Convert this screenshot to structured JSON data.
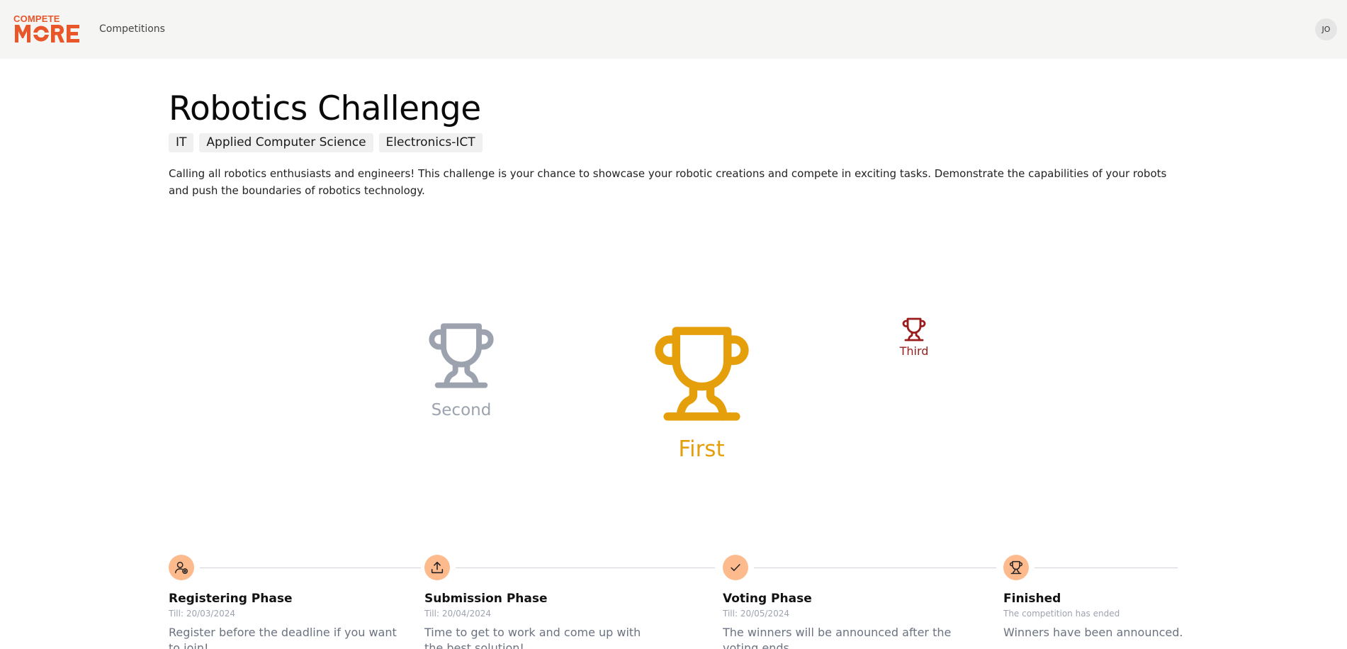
{
  "header": {
    "logo_top": "COMPETE",
    "logo_main": "MORE",
    "nav": [
      {
        "label": "Competitions"
      }
    ],
    "user_initials": "JO",
    "brand_color": "#e8562a"
  },
  "competition": {
    "title": "Robotics Challenge",
    "tags": [
      "IT",
      "Applied Computer Science",
      "Electronics-ICT"
    ],
    "description": "Calling all robotics enthusiasts and engineers! This challenge is your chance to showcase your robotic creations and compete in exciting tasks. Demonstrate the capabilities of your robots and push the boundaries of robotics technology."
  },
  "podium": {
    "second": {
      "label": "Second",
      "icon": "trophy-icon",
      "color": "#9ca3af"
    },
    "first": {
      "label": "First",
      "icon": "trophy-icon",
      "color": "#e59f0b"
    },
    "third": {
      "label": "Third",
      "icon": "trophy-icon",
      "color": "#991b1b"
    }
  },
  "phases": [
    {
      "title": "Registering Phase",
      "till": "Till: 20/03/2024",
      "description": "Register before the deadline if you want to join!",
      "icon": "user-plus-icon"
    },
    {
      "title": "Submission Phase",
      "till": "Till: 20/04/2024",
      "description": "Time to get to work and come up with the best solution!",
      "icon": "upload-icon"
    },
    {
      "title": "Voting Phase",
      "till": "Till: 20/05/2024",
      "description": "The winners will be announced after the voting ends.",
      "icon": "check-icon"
    },
    {
      "title": "Finished",
      "till": "The competition has ended",
      "description": "Winners have been announced.",
      "icon": "trophy-icon"
    }
  ],
  "colors": {
    "phase_dot": "#fdba8c",
    "header_bg": "#f5f5f4"
  }
}
